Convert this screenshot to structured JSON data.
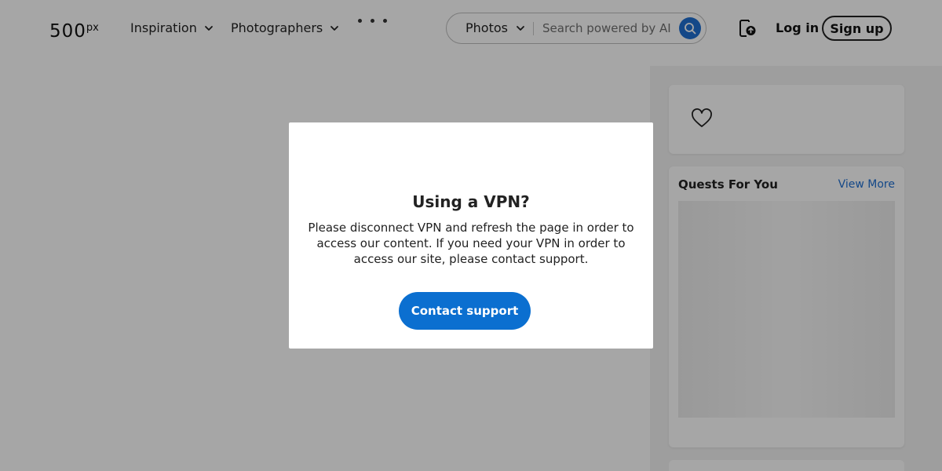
{
  "header": {
    "logo": {
      "main": "500",
      "sup": "px"
    },
    "nav": [
      {
        "label": "Inspiration",
        "icon": "chevron-down-icon"
      },
      {
        "label": "Photographers",
        "icon": "chevron-down-icon"
      }
    ],
    "more_icon": "more-dots-icon",
    "search": {
      "category": "Photos",
      "placeholder": "Search powered by AI",
      "button_icon": "search-icon",
      "accent": "#1f6fd1"
    },
    "upload_icon": "upload-photo-icon",
    "login_label": "Log in",
    "signup_label": "Sign up"
  },
  "sidebar": {
    "like_icon": "heart-icon",
    "quests": {
      "title": "Quests For You",
      "more_label": "View More"
    }
  },
  "modal": {
    "title": "Using a VPN?",
    "body": "Please disconnect VPN and refresh the page in order to access our content. If you need your VPN in order to access our site, please contact support.",
    "button_label": "Contact support",
    "button_color": "#0b6fd0"
  },
  "overlay_color": "rgba(0,0,0,0.35)"
}
